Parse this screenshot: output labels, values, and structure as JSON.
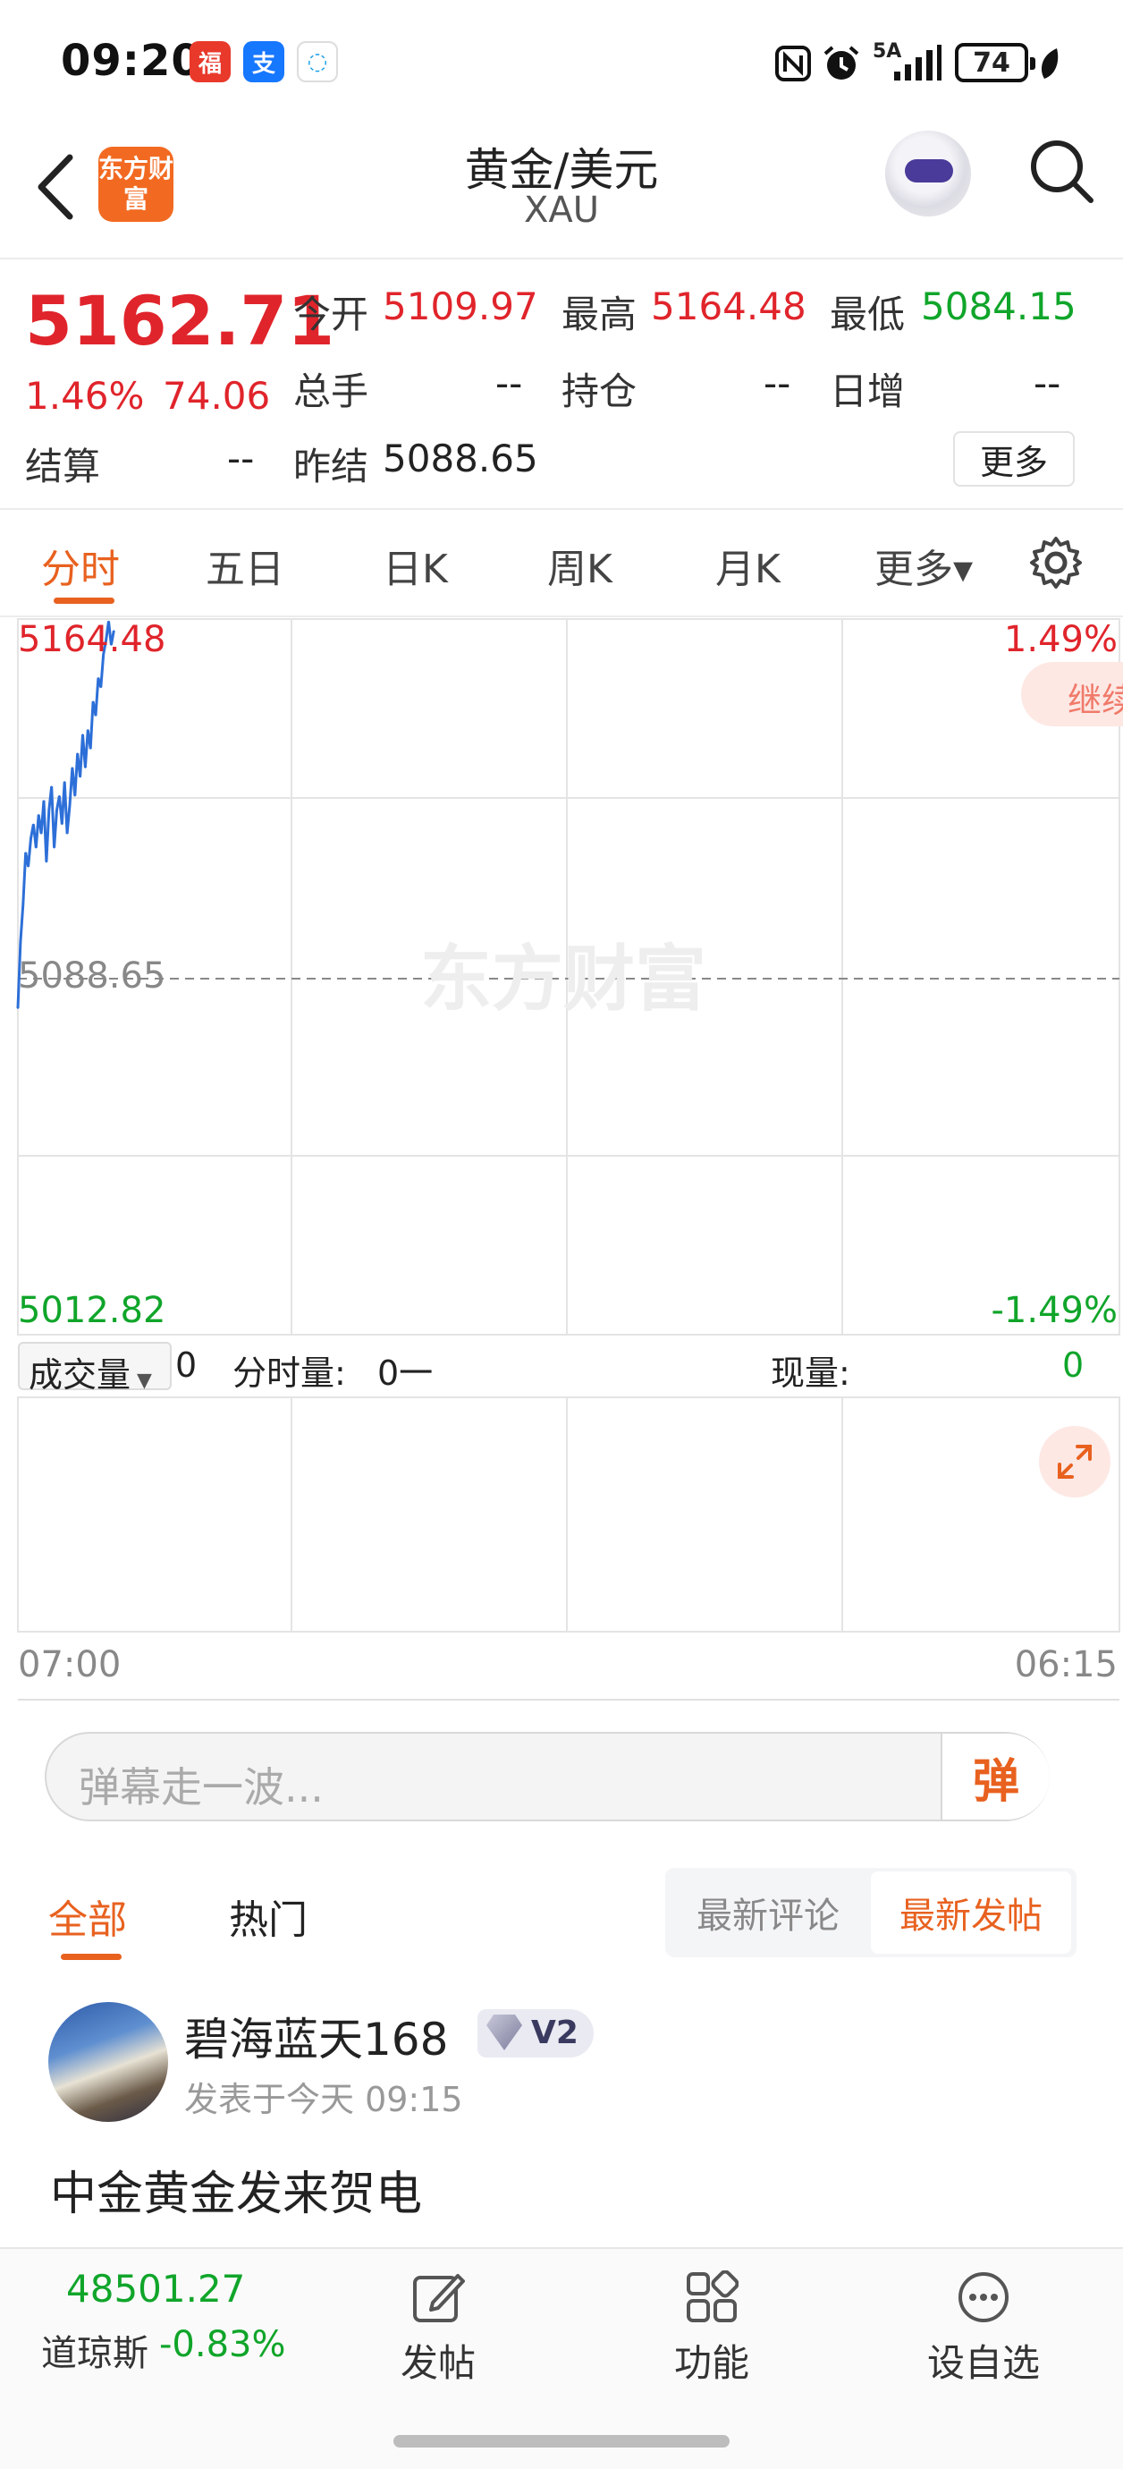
{
  "status_bar": {
    "time": "09:20",
    "network": "5A",
    "battery": "74"
  },
  "header": {
    "logo_text": "东方财富",
    "title": "黄金/美元",
    "subtitle": "XAU"
  },
  "quote": {
    "price": "5162.71",
    "change_pct": "1.46%",
    "change_abs": "74.06",
    "open_label": "今开",
    "open": "5109.97",
    "high_label": "最高",
    "high": "5164.48",
    "low_label": "最低",
    "low": "5084.15",
    "volume_label": "总手",
    "volume": "--",
    "position_label": "持仓",
    "position": "--",
    "daily_inc_label": "日增",
    "daily_inc": "--",
    "settle_label": "结算",
    "settle": "--",
    "prev_settle_label": "昨结",
    "prev_settle": "5088.65",
    "more_label": "更多"
  },
  "tabs": [
    {
      "label": "分时"
    },
    {
      "label": "五日"
    },
    {
      "label": "日K"
    },
    {
      "label": "周K"
    },
    {
      "label": "月K"
    },
    {
      "label": "更多▾"
    }
  ],
  "chart": {
    "y_max": "5164.48",
    "y_mid": "5088.65",
    "y_min": "5012.82",
    "pct_max": "1.49%",
    "pct_min": "-1.49%",
    "watermark": "东方财富",
    "continue_label": "继续",
    "vol_select": "成交量",
    "vol_value": "0",
    "tick_label": "分时量:",
    "tick_value": "0一",
    "cur_label": "现量:",
    "cur_value": "0",
    "t_start": "07:00",
    "t_end": "06:15"
  },
  "chart_data": {
    "type": "line",
    "title": "",
    "xlabel": "",
    "ylabel": "",
    "ylim": [
      5012.82,
      5164.48
    ],
    "x_range": [
      "07:00",
      "06:15"
    ],
    "reference_line": 5088.65,
    "series": [
      {
        "values": [
          5082,
          5096,
          5104,
          5115,
          5112,
          5118,
          5121,
          5116,
          5123,
          5119,
          5126,
          5113,
          5124,
          5129,
          5116,
          5124,
          5127,
          5121,
          5130,
          5119,
          5125,
          5133,
          5127,
          5136,
          5131,
          5140,
          5133,
          5141,
          5137,
          5147,
          5144,
          5152,
          5150,
          5157,
          5160,
          5164,
          5159,
          5162
        ]
      }
    ]
  },
  "danmu": {
    "placeholder": "弹幕走一波...",
    "button": "弹"
  },
  "post_tabs": {
    "all": "全部",
    "hot": "热门",
    "latest_comment": "最新评论",
    "latest_post": "最新发帖"
  },
  "post": {
    "username": "碧海蓝天168",
    "level": "V2",
    "time": "发表于今天 09:15",
    "text": "中金黄金发来贺电"
  },
  "bottom": {
    "dj_value": "48501.27",
    "dj_name": "道琼斯",
    "dj_pct": "-0.83%",
    "post_label": "发帖",
    "func_label": "功能",
    "watch_label": "设自选"
  }
}
